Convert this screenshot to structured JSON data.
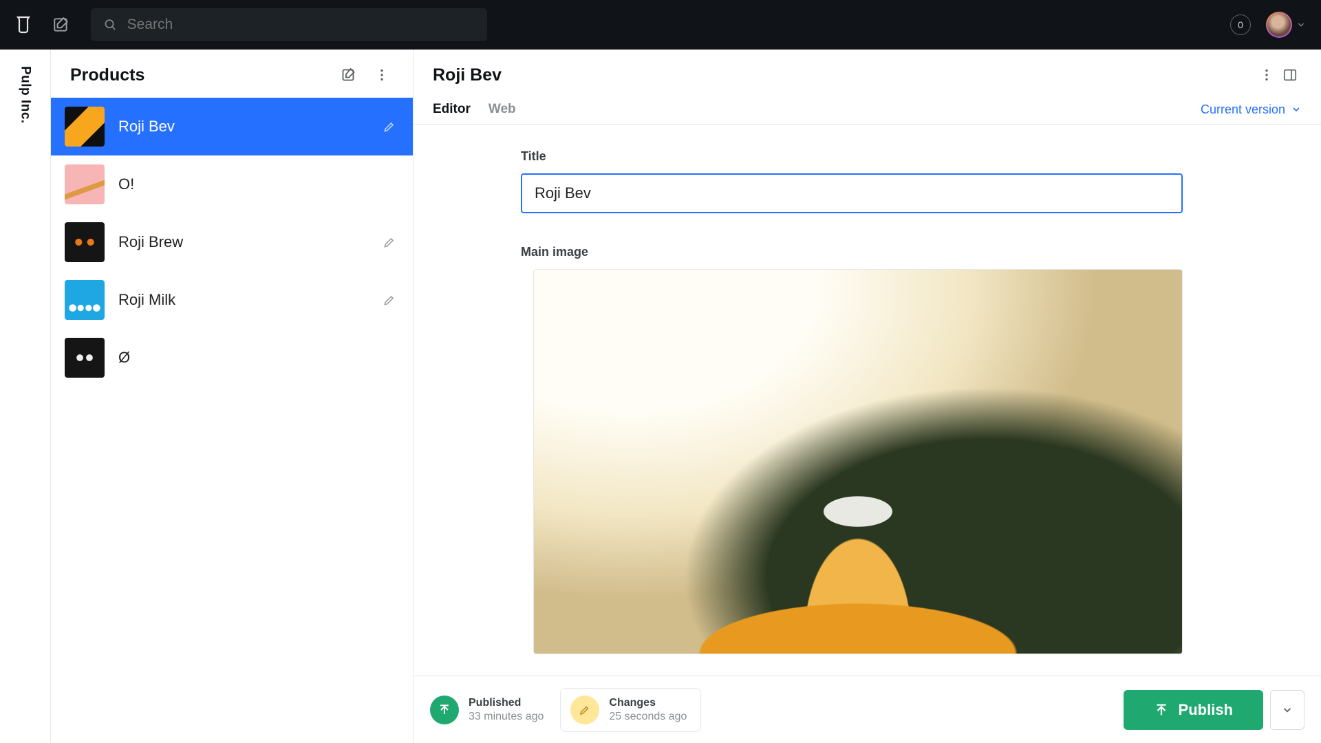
{
  "search": {
    "placeholder": "Search"
  },
  "notifications": {
    "count": "0"
  },
  "rail": {
    "org": "Pulp Inc."
  },
  "listPanel": {
    "title": "Products",
    "items": [
      {
        "name": "Roji Bev",
        "selected": true,
        "hasDraft": true
      },
      {
        "name": "O!",
        "selected": false,
        "hasDraft": false
      },
      {
        "name": "Roji Brew",
        "selected": false,
        "hasDraft": true
      },
      {
        "name": "Roji Milk",
        "selected": false,
        "hasDraft": true
      },
      {
        "name": "Ø",
        "selected": false,
        "hasDraft": false
      }
    ]
  },
  "editor": {
    "title": "Roji Bev",
    "tabs": {
      "editor": "Editor",
      "web": "Web"
    },
    "version": "Current version",
    "fields": {
      "titleLabel": "Title",
      "titleValue": "Roji Bev",
      "imageLabel": "Main image"
    }
  },
  "footer": {
    "published": {
      "label": "Published",
      "time": "33 minutes ago"
    },
    "changes": {
      "label": "Changes",
      "time": "25 seconds ago"
    },
    "publishButton": "Publish"
  }
}
